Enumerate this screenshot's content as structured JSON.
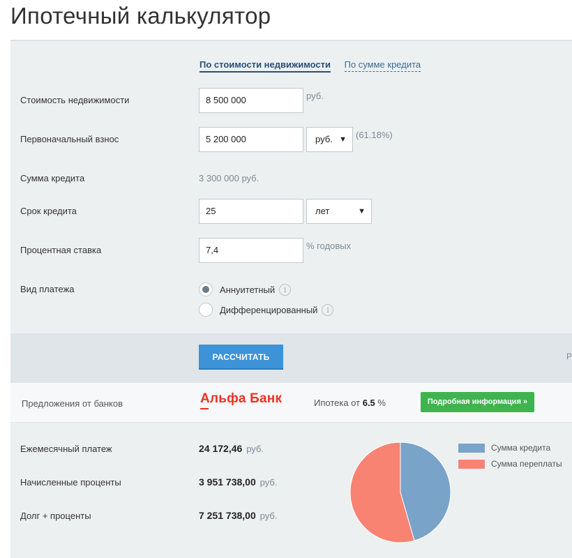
{
  "title": "Ипотечный калькулятор",
  "tabs": [
    {
      "label": "По стоимости недвижимости",
      "active": true
    },
    {
      "label": "По сумме кредита",
      "active": false
    }
  ],
  "fields": {
    "property_cost": {
      "label": "Стоимость недвижимости",
      "value": "8 500 000",
      "unit": "руб."
    },
    "down_payment": {
      "label": "Первоначальный взнос",
      "value": "5 200 000",
      "unit_select": "руб.",
      "percent": "(61.18%)"
    },
    "loan_amount": {
      "label": "Сумма кредита",
      "value": "3 300 000 руб."
    },
    "term": {
      "label": "Срок кредита",
      "value": "25",
      "unit_select": "лет"
    },
    "rate": {
      "label": "Процентная ставка",
      "value": "7,4",
      "unit": "% годовых"
    },
    "payment_type": {
      "label": "Вид платежа",
      "options": [
        {
          "label": "Аннуитетный",
          "checked": true
        },
        {
          "label": "Дифференцированный",
          "checked": false
        }
      ]
    }
  },
  "calculate_button": "РАССЧИТАТЬ",
  "edge_text": "Р",
  "offers": {
    "label": "Предложения от банков",
    "bank_name": "Альфа Банк",
    "rate_prefix": "Ипотека от",
    "rate_value": "6.5",
    "rate_suffix": "%",
    "more_button": "Подробная информация »"
  },
  "results": [
    {
      "label": "Ежемесячный платеж",
      "value": "24 172,46",
      "currency": "руб."
    },
    {
      "label": "Начисленные проценты",
      "value": "3 951 738,00",
      "currency": "руб."
    },
    {
      "label": "Долг + проценты",
      "value": "7 251 738,00",
      "currency": "руб."
    }
  ],
  "chart_data": {
    "type": "pie",
    "labels": [
      "Сумма кредита",
      "Сумма переплаты"
    ],
    "values": [
      3300000,
      3951738
    ],
    "colors": [
      "#7aa3c9",
      "#f88373"
    ]
  },
  "colors": {
    "accent_blue": "#3d93d6",
    "green": "#3fb34f",
    "bank_red": "#ee3124"
  }
}
